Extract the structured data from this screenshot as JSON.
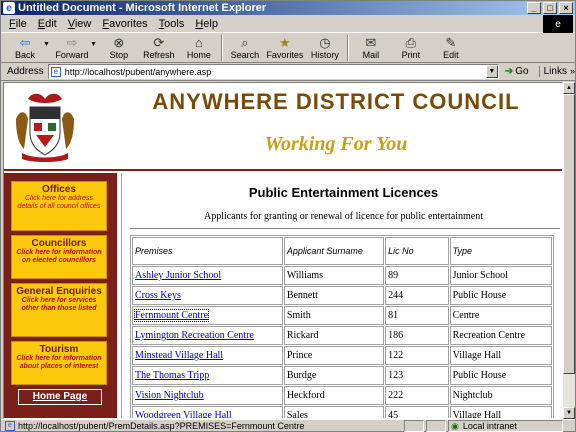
{
  "window": {
    "title": "Untitled Document - Microsoft Internet Explorer",
    "minimize": "_",
    "maximize": "□",
    "close": "×"
  },
  "menu": {
    "items": [
      "File",
      "Edit",
      "View",
      "Favorites",
      "Tools",
      "Help"
    ]
  },
  "toolbar": {
    "buttons": [
      {
        "label": "Back",
        "icon": "back-arrow-icon",
        "glyph": "⇦"
      },
      {
        "label": "Forward",
        "icon": "forward-arrow-icon",
        "glyph": "⇨"
      },
      {
        "label": "Stop",
        "icon": "stop-icon",
        "glyph": "⊗"
      },
      {
        "label": "Refresh",
        "icon": "refresh-icon",
        "glyph": "⟳"
      },
      {
        "label": "Home",
        "icon": "home-icon",
        "glyph": "⌂"
      },
      {
        "label": "Search",
        "icon": "search-icon",
        "glyph": "⌕"
      },
      {
        "label": "Favorites",
        "icon": "favorites-icon",
        "glyph": "★"
      },
      {
        "label": "History",
        "icon": "history-icon",
        "glyph": "◷"
      },
      {
        "label": "Mail",
        "icon": "mail-icon",
        "glyph": "✉"
      },
      {
        "label": "Print",
        "icon": "print-icon",
        "glyph": "⎙"
      },
      {
        "label": "Edit",
        "icon": "edit-icon",
        "glyph": "✎"
      }
    ]
  },
  "address": {
    "label": "Address",
    "url": "http://localhost/pubent/anywhere.asp",
    "go_label": "Go",
    "links_label": "Links"
  },
  "site": {
    "council_name": "ANYWHERE DISTRICT COUNCIL",
    "tagline": "Working For You"
  },
  "nav": {
    "cards": [
      {
        "title": "Offices",
        "desc": "Click here for address details of all council offices"
      },
      {
        "title": "Councillors",
        "desc": "Click here for information on elected councillors"
      },
      {
        "title": "General Enquiries",
        "desc": "Click here for services other than those listed"
      },
      {
        "title": "Tourism",
        "desc": "Click here for information about places of interest"
      }
    ],
    "home_label": "Home Page"
  },
  "content": {
    "heading": "Public Entertainment Licences",
    "subheading": "Applicants for granting or renewal of licence for public entertainment",
    "columns": [
      "Premises",
      "Applicant Surname",
      "Lic No",
      "Type"
    ],
    "rows": [
      {
        "premises": "Ashley Junior School",
        "surname": "Williams",
        "lic": "89",
        "type": "Junior School"
      },
      {
        "premises": "Cross Keys",
        "surname": "Bennett",
        "lic": "244",
        "type": "Public House"
      },
      {
        "premises": "Fernmount Centre",
        "surname": "Smith",
        "lic": "81",
        "type": "Centre"
      },
      {
        "premises": "Lymington Recreation Centre",
        "surname": "Rickard",
        "lic": "186",
        "type": "Recreation Centre"
      },
      {
        "premises": "Minstead Village Hall",
        "surname": "Prince",
        "lic": "122",
        "type": "Village Hall"
      },
      {
        "premises": "The Thomas Tripp",
        "surname": "Burdge",
        "lic": "123",
        "type": "Public House"
      },
      {
        "premises": "Vision Nightclub",
        "surname": "Heckford",
        "lic": "222",
        "type": "Nightclub"
      },
      {
        "premises": "Woodgreen Village Hall",
        "surname": "Sales",
        "lic": "45",
        "type": "Village Hall"
      }
    ]
  },
  "status": {
    "text": "http://localhost/pubent/PremDetails.asp?PREMISES=Fernmount Centre",
    "zone": "Local intranet"
  },
  "colors": {
    "nav_background": "#7a1f1a",
    "nav_card": "#fcc80c",
    "title_gold": "#c8a018",
    "council_brown": "#7a4a08",
    "link_blue": "#0000cc"
  }
}
